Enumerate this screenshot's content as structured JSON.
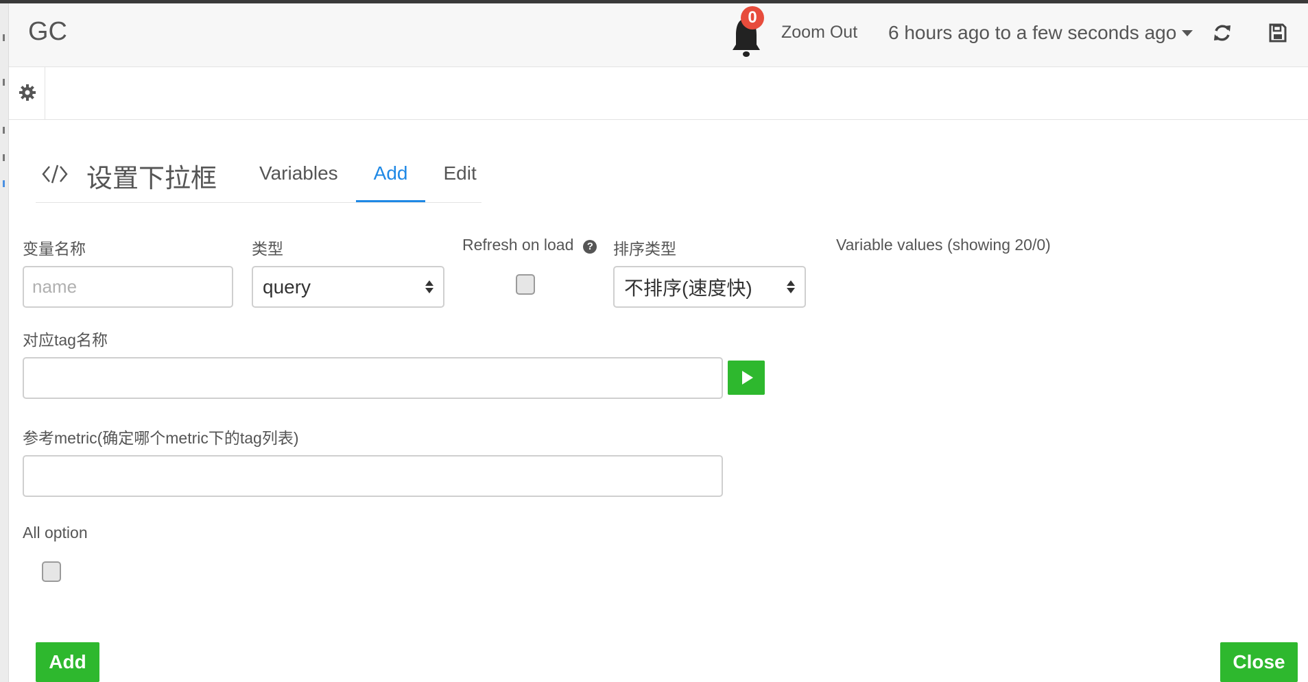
{
  "header": {
    "title": "GC",
    "alerts_count": "0",
    "zoom_out_label": "Zoom Out",
    "time_range_label": "6 hours ago to a few seconds ago"
  },
  "editor": {
    "title": "设置下拉框",
    "tabs": [
      {
        "label": "Variables",
        "active": false
      },
      {
        "label": "Add",
        "active": true
      },
      {
        "label": "Edit",
        "active": false
      }
    ]
  },
  "form": {
    "variable_name": {
      "label": "变量名称",
      "value": "",
      "placeholder": "name"
    },
    "type": {
      "label": "类型",
      "selected": "query"
    },
    "refresh_on_load": {
      "label": "Refresh on load",
      "checked": false
    },
    "sort_type": {
      "label": "排序类型",
      "selected": "不排序(速度快)"
    },
    "variable_values_label": "Variable values (showing 20/0)",
    "tag_name": {
      "label": "对应tag名称",
      "value": ""
    },
    "reference_metric": {
      "label": "参考metric(确定哪个metric下的tag列表)",
      "value": ""
    },
    "all_option": {
      "label": "All option",
      "checked": false
    }
  },
  "footer": {
    "add_label": "Add",
    "close_label": "Close"
  },
  "colors": {
    "accent": "#1e88e5",
    "success": "#2eb82e",
    "badge": "#e74c3c"
  },
  "icons": [
    "bell-icon",
    "refresh-icon",
    "save-icon",
    "gear-icon",
    "code-icon",
    "help-icon",
    "play-icon"
  ]
}
